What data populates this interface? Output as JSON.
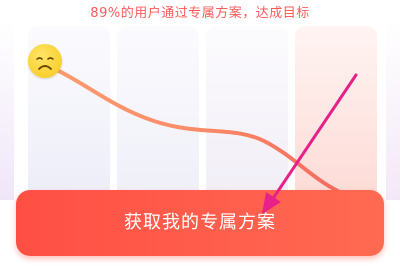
{
  "header": {
    "subtitle": "89%的用户通过专属方案，达成目标"
  },
  "cta": {
    "label": "获取我的专属方案"
  },
  "icons": {
    "mood": "sad-face-icon",
    "annotation": "arrow-icon"
  },
  "colors": {
    "accent": "#ff5a5a",
    "button": "#ff5548",
    "annotation_arrow": "#e8208a",
    "face": "#f7c61b"
  }
}
